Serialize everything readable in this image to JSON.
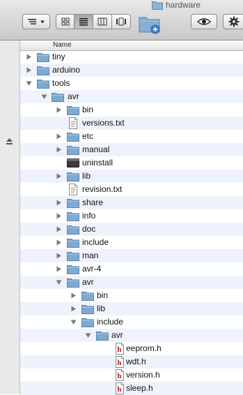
{
  "window": {
    "title": "hardware"
  },
  "columns": {
    "name": "Name"
  },
  "rows": [
    {
      "label": "tiny",
      "depth": 0,
      "disclosure": "closed",
      "icon": "folder-icon"
    },
    {
      "label": "arduino",
      "depth": 0,
      "disclosure": "closed",
      "icon": "folder-icon"
    },
    {
      "label": "tools",
      "depth": 0,
      "disclosure": "open",
      "icon": "folder-icon"
    },
    {
      "label": "avr",
      "depth": 1,
      "disclosure": "open",
      "icon": "folder-icon"
    },
    {
      "label": "bin",
      "depth": 2,
      "disclosure": "closed",
      "icon": "folder-icon"
    },
    {
      "label": "versions.txt",
      "depth": 2,
      "disclosure": "none",
      "icon": "text-file-icon"
    },
    {
      "label": "etc",
      "depth": 2,
      "disclosure": "closed",
      "icon": "folder-icon"
    },
    {
      "label": "manual",
      "depth": 2,
      "disclosure": "closed",
      "icon": "folder-icon"
    },
    {
      "label": "uninstall",
      "depth": 2,
      "disclosure": "none",
      "icon": "executable-icon"
    },
    {
      "label": "lib",
      "depth": 2,
      "disclosure": "closed",
      "icon": "folder-icon"
    },
    {
      "label": "revision.txt",
      "depth": 2,
      "disclosure": "none",
      "icon": "text-file-icon"
    },
    {
      "label": "share",
      "depth": 2,
      "disclosure": "closed",
      "icon": "folder-icon"
    },
    {
      "label": "info",
      "depth": 2,
      "disclosure": "closed",
      "icon": "folder-icon"
    },
    {
      "label": "doc",
      "depth": 2,
      "disclosure": "closed",
      "icon": "folder-icon"
    },
    {
      "label": "include",
      "depth": 2,
      "disclosure": "closed",
      "icon": "folder-icon"
    },
    {
      "label": "man",
      "depth": 2,
      "disclosure": "closed",
      "icon": "folder-icon"
    },
    {
      "label": "avr-4",
      "depth": 2,
      "disclosure": "closed",
      "icon": "folder-icon"
    },
    {
      "label": "avr",
      "depth": 2,
      "disclosure": "open",
      "icon": "folder-icon"
    },
    {
      "label": "bin",
      "depth": 3,
      "disclosure": "closed",
      "icon": "folder-icon"
    },
    {
      "label": "lib",
      "depth": 3,
      "disclosure": "closed",
      "icon": "folder-icon"
    },
    {
      "label": "include",
      "depth": 3,
      "disclosure": "open",
      "icon": "folder-icon"
    },
    {
      "label": "avr",
      "depth": 4,
      "disclosure": "open",
      "icon": "folder-icon"
    },
    {
      "label": "eeprom.h",
      "depth": 5,
      "disclosure": "none",
      "icon": "header-file-icon"
    },
    {
      "label": "wdt.h",
      "depth": 5,
      "disclosure": "none",
      "icon": "header-file-icon"
    },
    {
      "label": "version.h",
      "depth": 5,
      "disclosure": "none",
      "icon": "header-file-icon"
    },
    {
      "label": "sleep.h",
      "depth": 5,
      "disclosure": "none",
      "icon": "header-file-icon"
    }
  ],
  "colors": {
    "folder": "#7fa8cf",
    "stripe": "#eef3fb",
    "header_file_red": "#b3191f"
  }
}
